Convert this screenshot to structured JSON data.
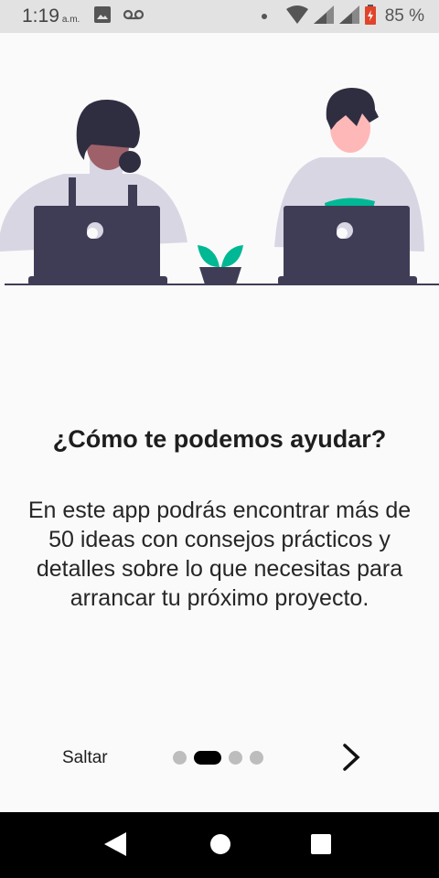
{
  "status_bar": {
    "time": "1:19",
    "ampm": "a.m.",
    "battery": "85 %"
  },
  "onboarding": {
    "headline": "¿Cómo te podemos ayudar?",
    "body": "En este app podrás encontrar más de 50 ideas con consejos prácticos y detalles sobre lo que necesitas para arrancar tu próximo proyecto.",
    "skip_label": "Saltar",
    "current_page": 2,
    "total_pages": 4
  },
  "colors": {
    "accent": "#00b894",
    "laptop": "#3f3d56",
    "shirt": "#d9d6e4",
    "skin": "#ffb8b8"
  }
}
